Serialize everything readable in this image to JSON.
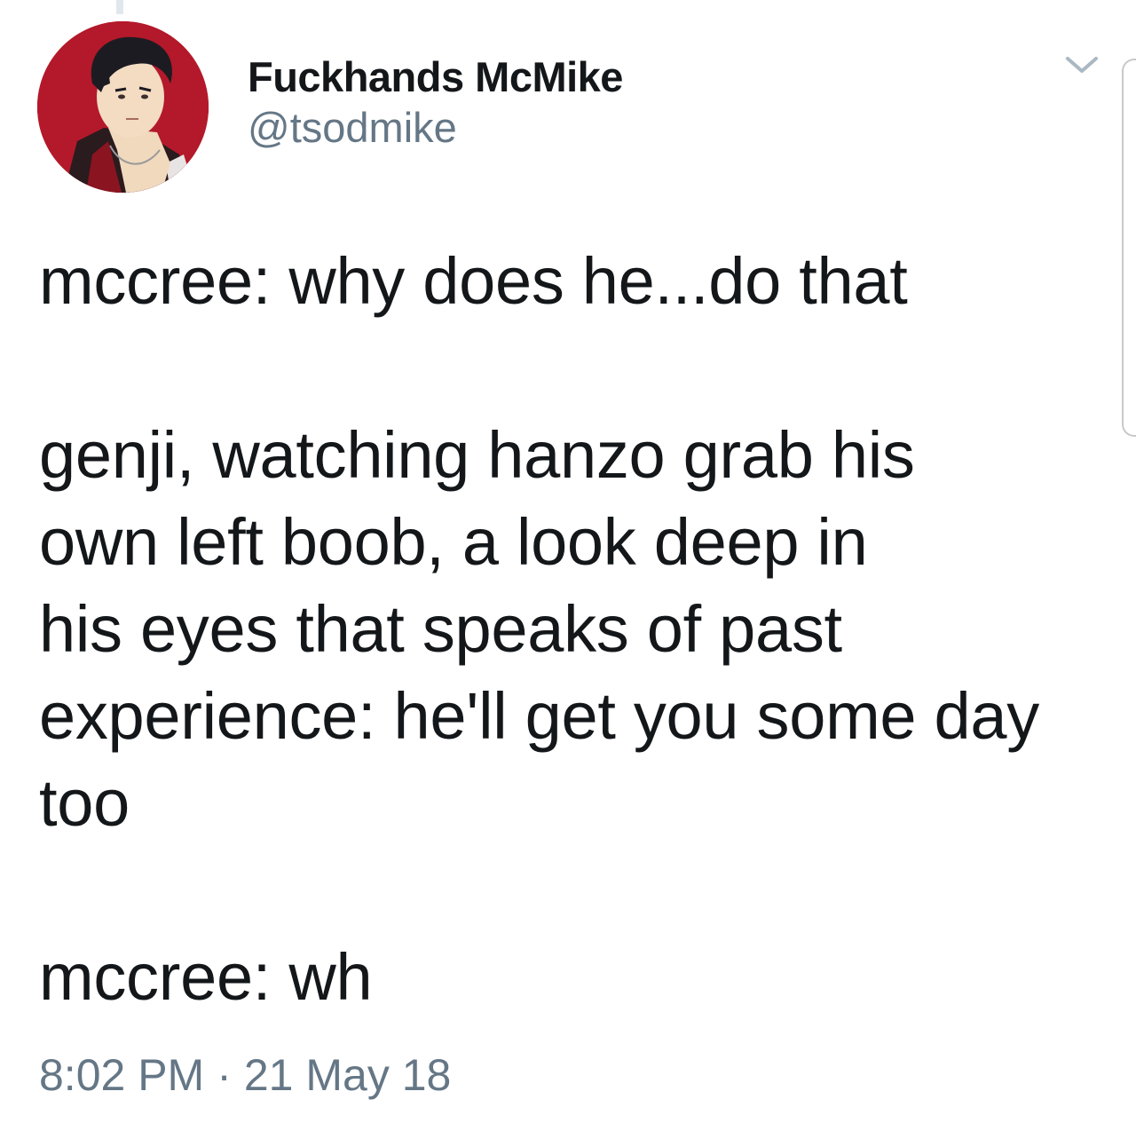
{
  "tweet": {
    "author": {
      "display_name": "Fuckhands McMike",
      "handle": "@tsodmike",
      "avatar_icon": "profile-avatar-illustration"
    },
    "body_lines": [
      "mccree: why does he...do that",
      "",
      "genji, watching hanzo grab his",
      "own left boob, a look deep in",
      "his eyes that speaks of past",
      "experience: he'll get you some day",
      "too",
      "",
      "mccree: wh"
    ],
    "time": "8:02 PM",
    "separator": "·",
    "date": "21 May 18",
    "menu_icon": "chevron-down-icon"
  },
  "colors": {
    "text_primary": "#14171a",
    "text_secondary": "#657786",
    "avatar_background": "#b3192a",
    "divider": "#e1e8ed"
  }
}
